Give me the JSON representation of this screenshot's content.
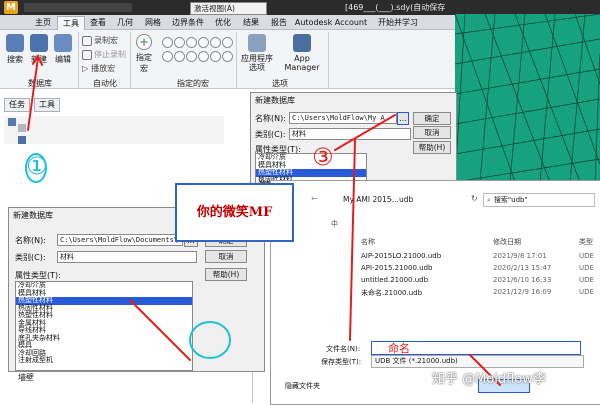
{
  "window": {
    "title": "[469___(___).sdy(自动保存",
    "dropdown": "激活视图(A)"
  },
  "menu": [
    "主页",
    "工具",
    "查看",
    "几何",
    "网格",
    "边界条件",
    "优化",
    "结果",
    "报告",
    "Autodesk Account",
    "开始并学习"
  ],
  "ribbon": {
    "buttons": [
      "搜索",
      "新建",
      "编辑"
    ],
    "db_group": "数据库",
    "auto": {
      "record": "录制宏",
      "stop": "停止录制",
      "play": "播放宏",
      "group": "自动化"
    },
    "assign": {
      "label": "指定宏",
      "group": "指定的宏"
    },
    "options": {
      "app": "应用程序选项",
      "manager": "App Manager",
      "group": "选项"
    }
  },
  "panel": {
    "tabs": [
      "任务",
      "工具"
    ],
    "bottom_text": "墙壁"
  },
  "dialog_large": {
    "title": "新建数据库",
    "name_label": "名称(N):",
    "name_value": "C:\\Users\\MoldFlow\\Documents\\My AM",
    "type_label": "类别(C):",
    "type_value": "材料",
    "attr_label": "属性类型(T):",
    "list": [
      "冷却介质",
      "模具材料",
      "热塑性材料",
      "热固性材料",
      "热塑性材料",
      "金属材料",
      "导线材料",
      "底孔夹杂材料",
      "模具",
      "冷却回路",
      "注射成型机",
      "预设(3D)",
      "折拉射出(3D)"
    ],
    "selected": 2,
    "buttons": [
      "确定",
      "取消",
      "帮助(H)"
    ]
  },
  "dialog_small": {
    "title": "新建数据库",
    "name_label": "名称(N):",
    "name_value": "C:\\Users\\MoldFlow\\My A",
    "type_label": "类别(C):",
    "type_value": "材料",
    "attr_label": "属性类型(T):",
    "list": [
      "冷却介质",
      "模具材料",
      "热塑性材料",
      "热固性材料",
      "金属材料"
    ],
    "selected": 2,
    "buttons": [
      "确定",
      "取消",
      "帮助(H)"
    ],
    "extra": "数据库名称"
  },
  "save_dialog": {
    "path": [
      "My AMI 2015...",
      "udb"
    ],
    "search": "搜索\"udb\"",
    "headers": [
      "名称",
      "修改日期",
      "类型"
    ],
    "files": [
      {
        "name": "AIP-2015LO.21000.udb",
        "date": "2021/9/8 17:01",
        "type": "UDE"
      },
      {
        "name": "API-2015.21000.udb",
        "date": "2020/2/13 15:47",
        "type": "UDE"
      },
      {
        "name": "untitled.21000.udb",
        "date": "2021/6/10 16:33",
        "type": "UDE"
      },
      {
        "name": "未命名.21000.udb",
        "date": "2021/12/9 16:09",
        "type": "UDE"
      }
    ],
    "filename_label": "文件名(N):",
    "filetype_label": "保存类型(T):",
    "filetype_value": "UDB 文件 (*.21000.udb)",
    "hide": "隐藏文件夹",
    "side_label": "中"
  },
  "annotations": {
    "callout": "你的微笑MF",
    "one": "①",
    "three": "③",
    "rename": "命名"
  },
  "watermark": "知乎 @Moldflow李",
  "colors": {
    "accent": "#2a5bd7",
    "annotation_red": "#e02020",
    "annotation_cyan": "#1ec0d8",
    "mesh_green": "#17a27f"
  }
}
